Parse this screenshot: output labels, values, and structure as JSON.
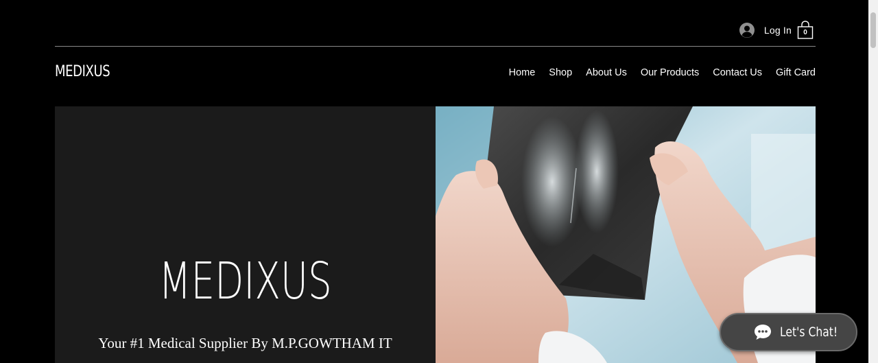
{
  "header": {
    "login_label": "Log In",
    "cart_count": "0",
    "logo_text": "MEDIXUS"
  },
  "nav": {
    "items": [
      {
        "label": "Home"
      },
      {
        "label": "Shop"
      },
      {
        "label": "About Us"
      },
      {
        "label": "Our Products"
      },
      {
        "label": "Contact Us"
      },
      {
        "label": "Gift Card"
      }
    ]
  },
  "hero": {
    "title": "MEDIXUS",
    "subtitle": "Your #1 Medical Supplier By M.P.GOWTHAM IT",
    "image_subject": "hands holding x-ray film"
  },
  "chat": {
    "label": "Let's Chat!"
  },
  "icons": {
    "avatar": "user-avatar-icon",
    "cart": "shopping-bag-icon",
    "chat": "chat-bubble-icon"
  },
  "colors": {
    "background": "#000000",
    "hero_panel": "#1b1b1b",
    "chat_button": "#454545"
  }
}
